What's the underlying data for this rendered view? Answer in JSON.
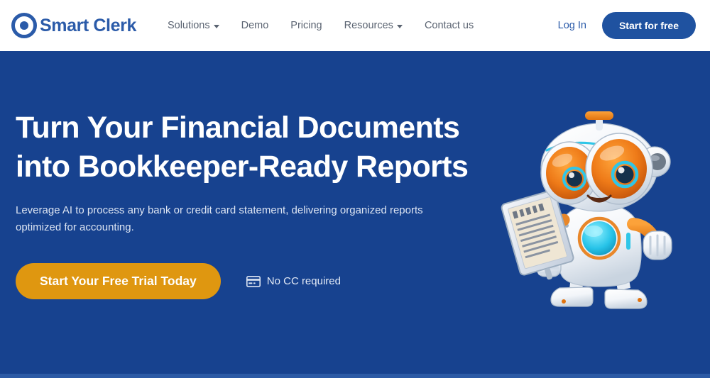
{
  "brand": {
    "name": "Smart Clerk",
    "logo_icon": "bullseye-target-icon",
    "color": "#2B5BA9"
  },
  "header": {
    "nav": [
      {
        "label": "Solutions",
        "has_dropdown": true
      },
      {
        "label": "Demo",
        "has_dropdown": false
      },
      {
        "label": "Pricing",
        "has_dropdown": false
      },
      {
        "label": "Resources",
        "has_dropdown": true
      },
      {
        "label": "Contact us",
        "has_dropdown": false
      }
    ],
    "login_label": "Log In",
    "cta_label": "Start for free",
    "cta_color": "#1F52A0",
    "background": "#FFFFFF"
  },
  "hero": {
    "title_line1": "Turn Your Financial Documents",
    "title_line2": "into Bookkeeper-Ready Reports",
    "subtitle": "Leverage AI to process any bank or credit card statement, delivering organized reports optimized for accounting.",
    "cta_label": "Start Your Free Trial Today",
    "cta_color": "#DF9710",
    "note_label": "No CC required",
    "note_icon": "credit-card-icon",
    "background": "#17428F",
    "illustration": "robot-mascot-holding-document"
  }
}
